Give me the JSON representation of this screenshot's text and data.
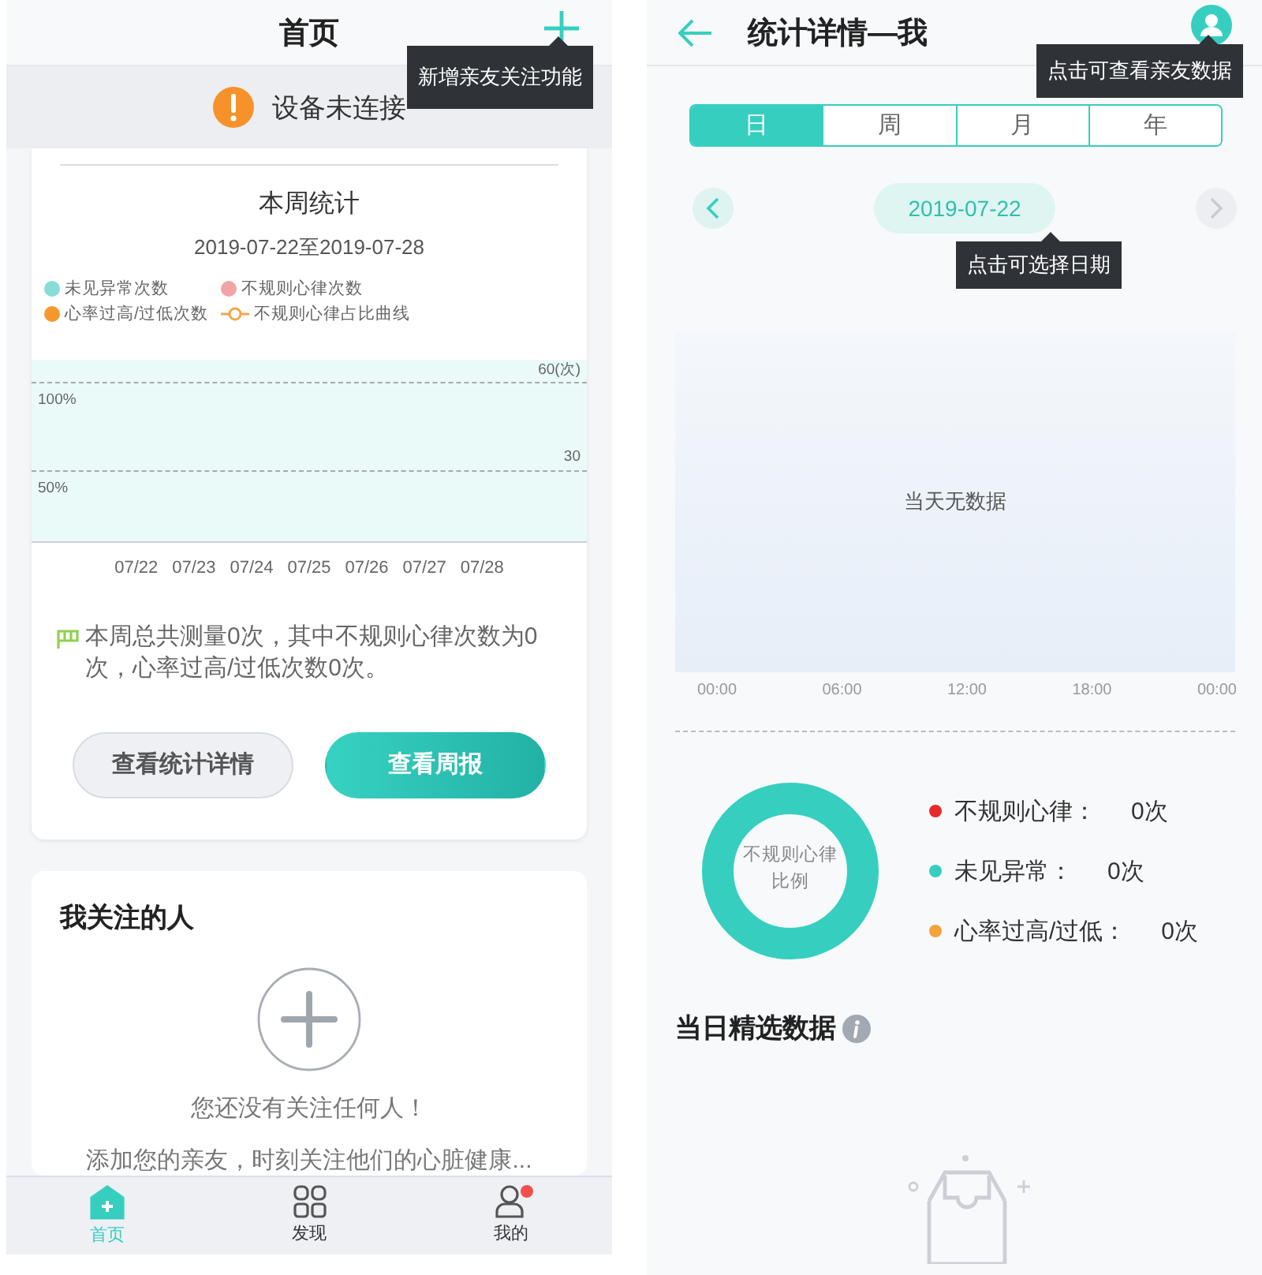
{
  "home": {
    "header": {
      "title": "首页"
    },
    "add_tooltip": "新增亲友关注功能",
    "device_banner": {
      "text": "设备未连接"
    },
    "weekly_card": {
      "title": "本周统计",
      "date_range": "2019-07-22至2019-07-28",
      "legend": [
        {
          "label": "未见异常次数",
          "color": "#86ddd5",
          "kind": "dot"
        },
        {
          "label": "不规则心律次数",
          "color": "#f2a3a3",
          "kind": "dot"
        },
        {
          "label": "心率过高/过低次数",
          "color": "#f7982e",
          "kind": "dot"
        },
        {
          "label": "不规则心律占比曲线",
          "color": "#f5a54a",
          "kind": "line"
        }
      ],
      "gridlines": [
        {
          "count": "60(次)",
          "percent": "100%"
        },
        {
          "count": "30",
          "percent": "50%"
        }
      ],
      "x_labels": [
        "07/22",
        "07/23",
        "07/24",
        "07/25",
        "07/26",
        "07/27",
        "07/28"
      ],
      "summary": "本周总共测量0次，其中不规则心律次数为0次，心率过高/过低次数0次。",
      "buttons": [
        {
          "label": "查看统计详情",
          "kind": "secondary"
        },
        {
          "label": "查看周报",
          "kind": "primary"
        }
      ]
    },
    "following_card": {
      "title": "我关注的人",
      "empty_title": "您还没有关注任何人！",
      "empty_text": "添加您的亲友，时刻关注他们的心脏健康..."
    },
    "tab_bar": [
      {
        "label": "首页",
        "selected": true,
        "badge": false,
        "kind": "home"
      },
      {
        "label": "发现",
        "selected": false,
        "badge": false,
        "kind": "grid"
      },
      {
        "label": "我的",
        "selected": false,
        "badge": true,
        "kind": "person"
      }
    ]
  },
  "details": {
    "header": {
      "title": "统计详情—我"
    },
    "friends_tooltip": "点击可查看亲友数据",
    "period_tabs": [
      {
        "label": "日",
        "selected": true
      },
      {
        "label": "周",
        "selected": false
      },
      {
        "label": "月",
        "selected": false
      },
      {
        "label": "年",
        "selected": false
      }
    ],
    "date_nav": {
      "date": "2019-07-22",
      "prev_disabled": false,
      "next_disabled": true
    },
    "date_tooltip": "点击可选择日期",
    "day_chart": {
      "empty_text": "当天无数据",
      "x_labels": [
        "00:00",
        "06:00",
        "12:00",
        "18:00",
        "00:00"
      ]
    },
    "ratio": {
      "center_label": "不规则心律比例",
      "legend": [
        {
          "label": "不规则心律：",
          "value": "0次",
          "color": "#e8292b"
        },
        {
          "label": "未见异常：",
          "value": "0次",
          "color": "#36cfbf"
        },
        {
          "label": "心率过高/过低：",
          "value": "0次",
          "color": "#f5a23a"
        }
      ]
    },
    "selected_section": {
      "title": "当日精选数据"
    }
  }
}
